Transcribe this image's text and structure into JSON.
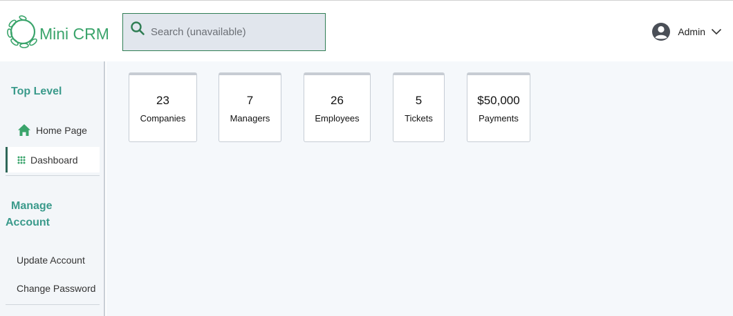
{
  "app": {
    "title": "Mini CRM"
  },
  "search": {
    "placeholder": "Search (unavailable)"
  },
  "user": {
    "name": "Admin"
  },
  "sidebar": {
    "sections": [
      {
        "title": "Top Level",
        "items": [
          {
            "label": "Home Page",
            "icon": "home-icon"
          },
          {
            "label": "Dashboard",
            "icon": "grid-icon",
            "active": true
          }
        ]
      },
      {
        "title_line1": "Manage",
        "title_line2": "Account",
        "items": [
          {
            "label": "Update Account"
          },
          {
            "label": "Change Password"
          }
        ]
      }
    ]
  },
  "stats": [
    {
      "value": "23",
      "label": "Companies"
    },
    {
      "value": "7",
      "label": "Managers"
    },
    {
      "value": "26",
      "label": "Employees"
    },
    {
      "value": "5",
      "label": "Tickets"
    },
    {
      "value": "$50,000",
      "label": "Payments"
    }
  ],
  "colors": {
    "brand": "#3aa46b",
    "section_title": "#3a9a8b",
    "active_bar": "#2e6658"
  }
}
